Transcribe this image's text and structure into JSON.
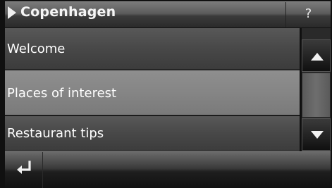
{
  "header": {
    "title": "Copenhagen",
    "help_label": "?",
    "arrow_icon": "play-arrow-icon"
  },
  "list": {
    "items": [
      {
        "label": "Welcome",
        "selected": false
      },
      {
        "label": "Places of interest",
        "selected": true
      },
      {
        "label": "Restaurant tips",
        "selected": false
      }
    ]
  },
  "scrollbar": {
    "up_icon": "triangle-up-icon",
    "down_icon": "triangle-down-icon"
  },
  "footer": {
    "back_icon": "return-arrow-icon"
  },
  "colors": {
    "selected_row": "#858585",
    "row": "#484848",
    "text": "#ffffff"
  }
}
